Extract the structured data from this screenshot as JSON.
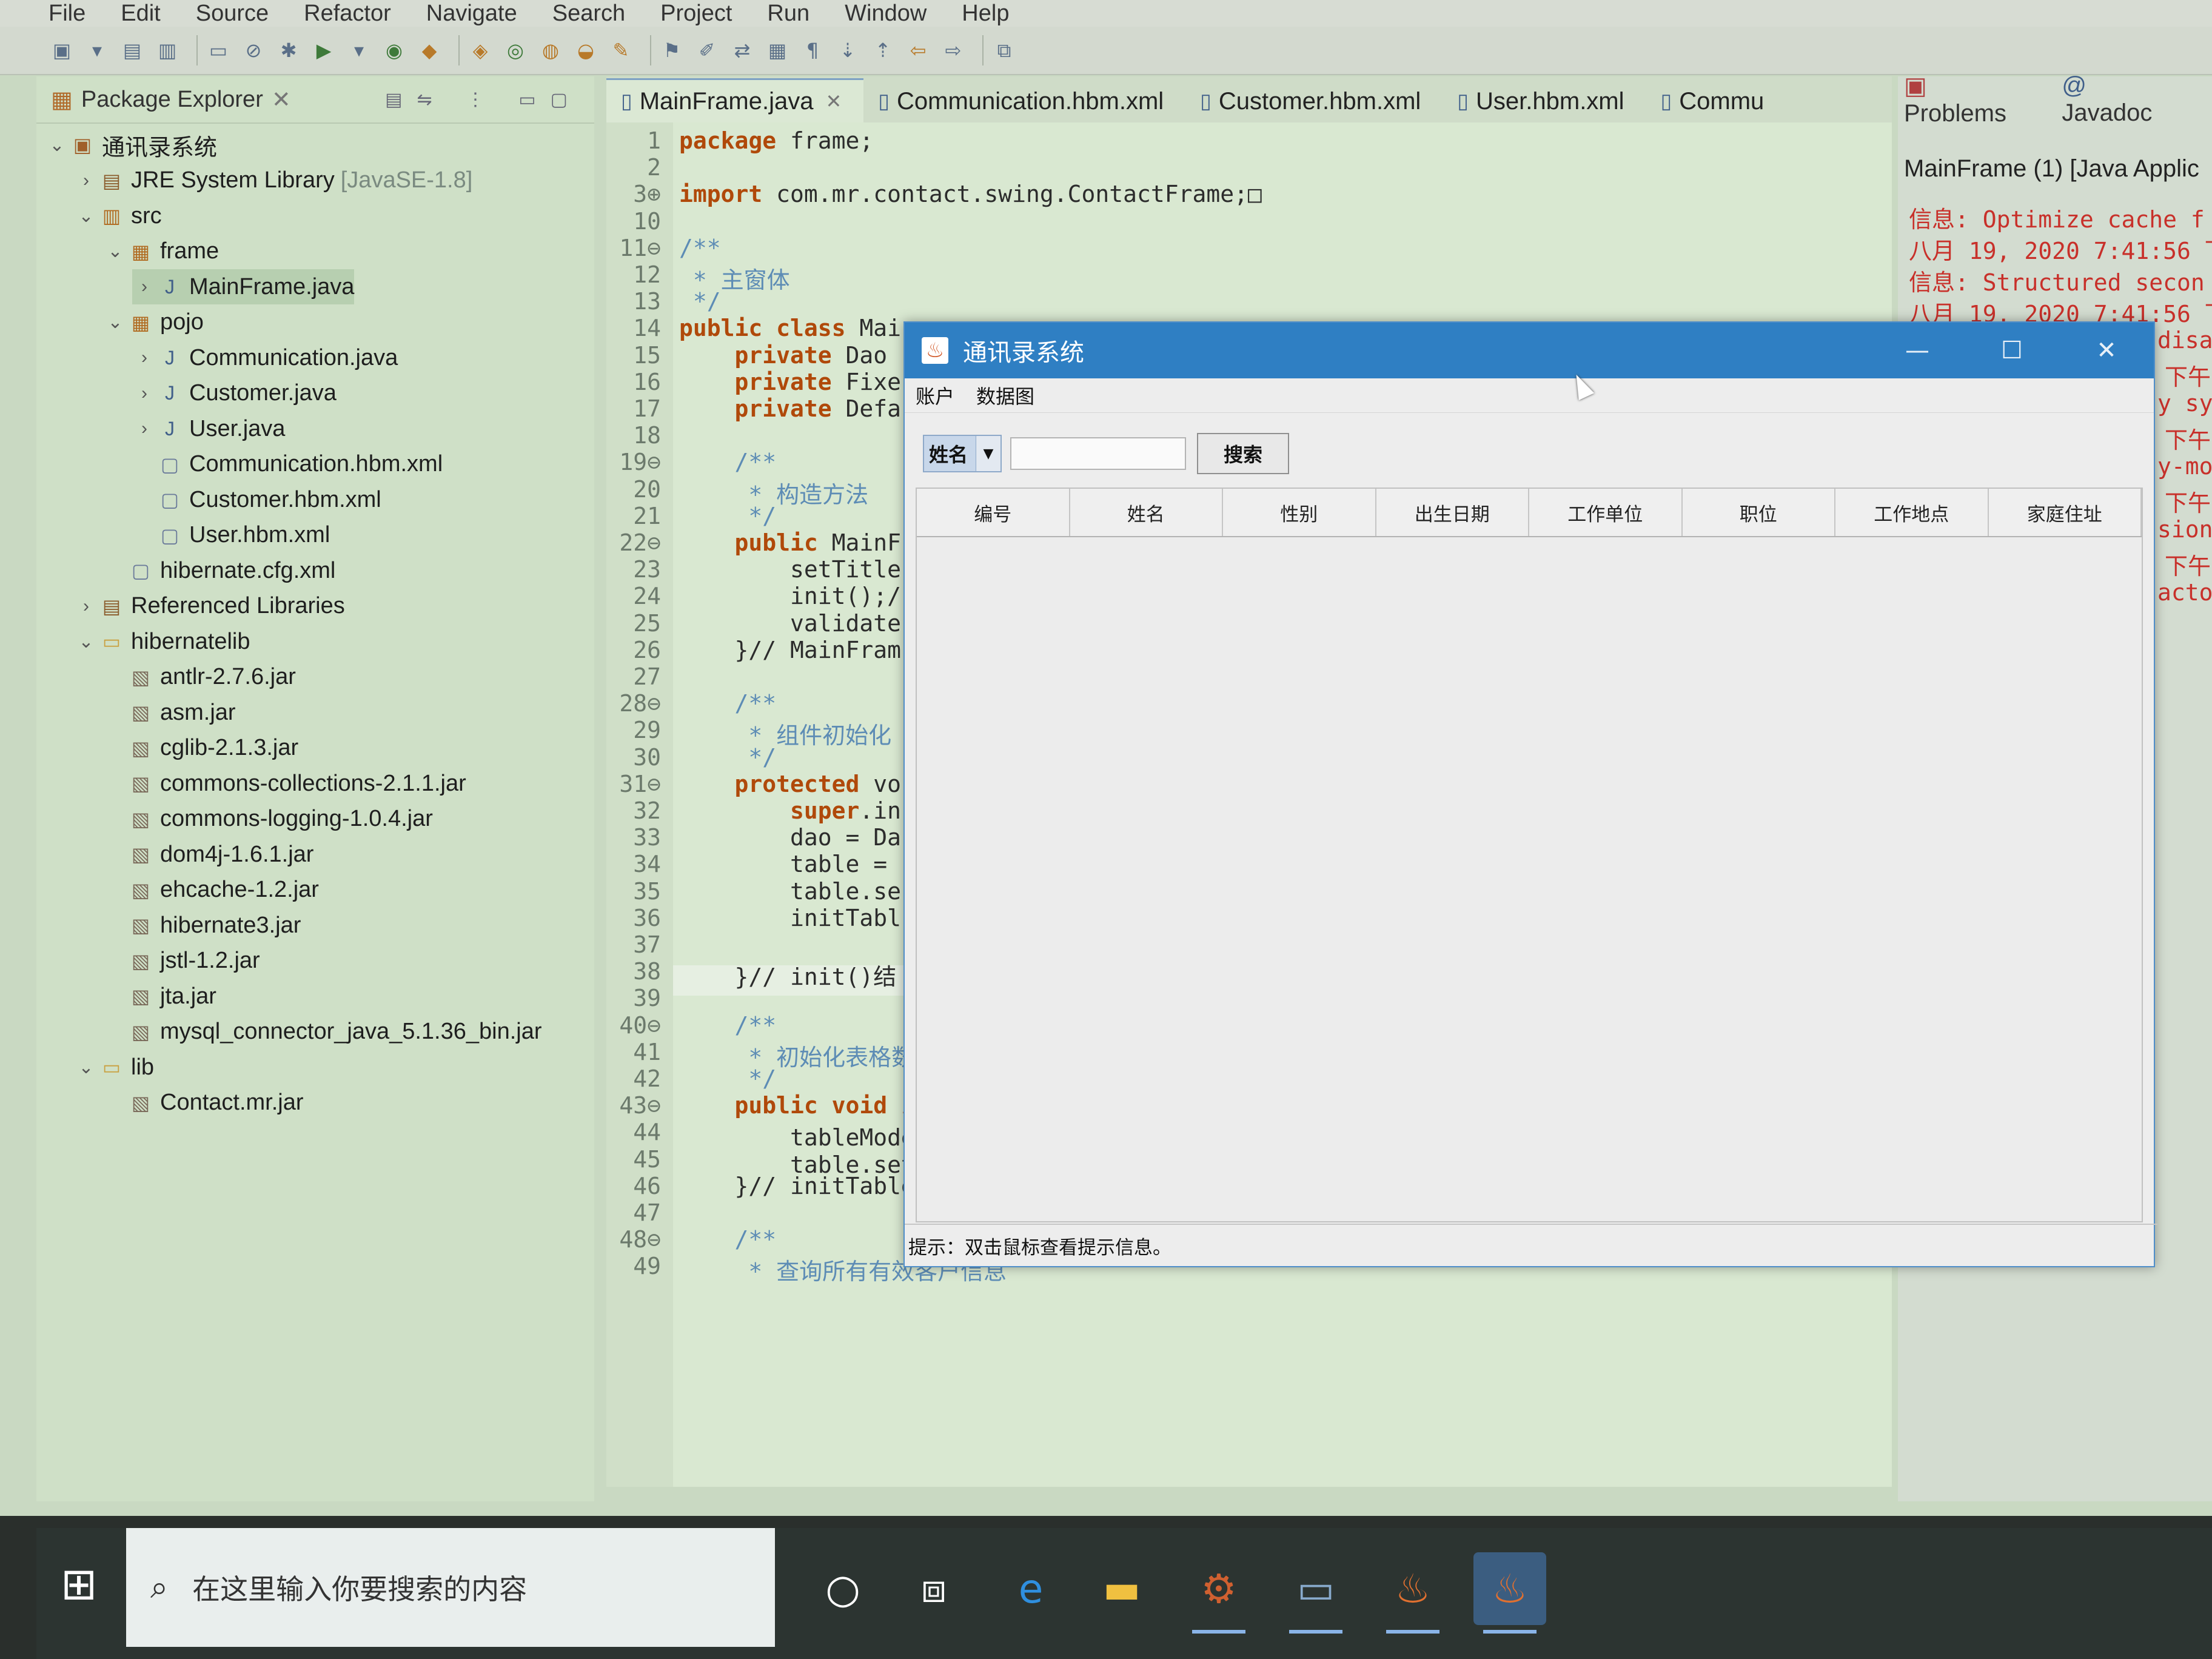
{
  "menubar": [
    "File",
    "Edit",
    "Source",
    "Refactor",
    "Navigate",
    "Search",
    "Project",
    "Run",
    "Window",
    "Help"
  ],
  "package_explorer": {
    "title": "Package Explorer",
    "tree": [
      {
        "label": "通讯录系统",
        "suffix": "",
        "icon": "project-icon",
        "depth": 0,
        "arrow": "v"
      },
      {
        "label": "JRE System Library",
        "suffix": "[JavaSE-1.8]",
        "icon": "library-icon",
        "depth": 1,
        "arrow": ">"
      },
      {
        "label": "src",
        "suffix": "",
        "icon": "source-folder-icon",
        "depth": 1,
        "arrow": "v"
      },
      {
        "label": "frame",
        "suffix": "",
        "icon": "package-icon",
        "depth": 2,
        "arrow": "v"
      },
      {
        "label": "MainFrame.java",
        "suffix": "",
        "icon": "java-file-icon",
        "depth": 3,
        "arrow": ">",
        "selected": true
      },
      {
        "label": "pojo",
        "suffix": "",
        "icon": "package-icon",
        "depth": 2,
        "arrow": "v"
      },
      {
        "label": "Communication.java",
        "suffix": "",
        "icon": "java-file-icon",
        "depth": 3,
        "arrow": ">"
      },
      {
        "label": "Customer.java",
        "suffix": "",
        "icon": "java-file-icon",
        "depth": 3,
        "arrow": ">"
      },
      {
        "label": "User.java",
        "suffix": "",
        "icon": "java-file-icon",
        "depth": 3,
        "arrow": ">"
      },
      {
        "label": "Communication.hbm.xml",
        "suffix": "",
        "icon": "xml-file-icon",
        "depth": 3,
        "arrow": ""
      },
      {
        "label": "Customer.hbm.xml",
        "suffix": "",
        "icon": "xml-file-icon",
        "depth": 3,
        "arrow": ""
      },
      {
        "label": "User.hbm.xml",
        "suffix": "",
        "icon": "xml-file-icon",
        "depth": 3,
        "arrow": ""
      },
      {
        "label": "hibernate.cfg.xml",
        "suffix": "",
        "icon": "xml-file-icon",
        "depth": 2,
        "arrow": ""
      },
      {
        "label": "Referenced Libraries",
        "suffix": "",
        "icon": "library-icon",
        "depth": 1,
        "arrow": ">"
      },
      {
        "label": "hibernatelib",
        "suffix": "",
        "icon": "folder-icon",
        "depth": 1,
        "arrow": "v"
      },
      {
        "label": "antlr-2.7.6.jar",
        "suffix": "",
        "icon": "jar-icon",
        "depth": 2,
        "arrow": ""
      },
      {
        "label": "asm.jar",
        "suffix": "",
        "icon": "jar-icon",
        "depth": 2,
        "arrow": ""
      },
      {
        "label": "cglib-2.1.3.jar",
        "suffix": "",
        "icon": "jar-icon",
        "depth": 2,
        "arrow": ""
      },
      {
        "label": "commons-collections-2.1.1.jar",
        "suffix": "",
        "icon": "jar-icon",
        "depth": 2,
        "arrow": ""
      },
      {
        "label": "commons-logging-1.0.4.jar",
        "suffix": "",
        "icon": "jar-icon",
        "depth": 2,
        "arrow": ""
      },
      {
        "label": "dom4j-1.6.1.jar",
        "suffix": "",
        "icon": "jar-icon",
        "depth": 2,
        "arrow": ""
      },
      {
        "label": "ehcache-1.2.jar",
        "suffix": "",
        "icon": "jar-icon",
        "depth": 2,
        "arrow": ""
      },
      {
        "label": "hibernate3.jar",
        "suffix": "",
        "icon": "jar-icon",
        "depth": 2,
        "arrow": ""
      },
      {
        "label": "jstl-1.2.jar",
        "suffix": "",
        "icon": "jar-icon",
        "depth": 2,
        "arrow": ""
      },
      {
        "label": "jta.jar",
        "suffix": "",
        "icon": "jar-icon",
        "depth": 2,
        "arrow": ""
      },
      {
        "label": "mysql_connector_java_5.1.36_bin.jar",
        "suffix": "",
        "icon": "jar-icon",
        "depth": 2,
        "arrow": ""
      },
      {
        "label": "lib",
        "suffix": "",
        "icon": "folder-icon",
        "depth": 1,
        "arrow": "v"
      },
      {
        "label": "Contact.mr.jar",
        "suffix": "",
        "icon": "jar-icon",
        "depth": 2,
        "arrow": ""
      }
    ]
  },
  "editor_tabs": [
    {
      "label": "MainFrame.java",
      "active": true,
      "closable": true
    },
    {
      "label": "Communication.hbm.xml",
      "active": false,
      "closable": false
    },
    {
      "label": "Customer.hbm.xml",
      "active": false,
      "closable": false
    },
    {
      "label": "User.hbm.xml",
      "active": false,
      "closable": false
    },
    {
      "label": "Commu",
      "active": false,
      "closable": false
    }
  ],
  "code_lines": [
    {
      "n": "1",
      "html": "<span class='kw'>package</span> <span class='pl'>frame</span>;"
    },
    {
      "n": "2",
      "html": ""
    },
    {
      "n": "3⊕",
      "html": "<span class='kw'>import</span> com.mr.contact.swing.ContactFrame;□"
    },
    {
      "n": "10",
      "html": ""
    },
    {
      "n": "11⊖",
      "html": "<span class='cm'>/**</span>"
    },
    {
      "n": "12",
      "html": "<span class='cm'> * 主窗体</span>"
    },
    {
      "n": "13",
      "html": "<span class='cm'> */</span>"
    },
    {
      "n": "14",
      "html": "<span class='kw'>public class</span> Mai"
    },
    {
      "n": "15",
      "html": "    <span class='kw'>private</span> Dao"
    },
    {
      "n": "16",
      "html": "    <span class='kw'>private</span> Fixe"
    },
    {
      "n": "17",
      "html": "    <span class='kw'>private</span> Defa"
    },
    {
      "n": "18",
      "html": ""
    },
    {
      "n": "19⊖",
      "html": "    <span class='cm'>/**</span>"
    },
    {
      "n": "20",
      "html": "<span class='cm'>     * 构造方法</span>"
    },
    {
      "n": "21",
      "html": "<span class='cm'>     */</span>"
    },
    {
      "n": "22⊖",
      "html": "    <span class='kw'>public</span> MainF"
    },
    {
      "n": "23",
      "html": "        setTitle"
    },
    {
      "n": "24",
      "html": "        init();/"
    },
    {
      "n": "25",
      "html": "        validate"
    },
    {
      "n": "26",
      "html": "    }// MainFram"
    },
    {
      "n": "27",
      "html": ""
    },
    {
      "n": "28⊖",
      "html": "    <span class='cm'>/**</span>"
    },
    {
      "n": "29",
      "html": "<span class='cm'>     * 组件初始化</span>"
    },
    {
      "n": "30",
      "html": "<span class='cm'>     */</span>"
    },
    {
      "n": "31⊖",
      "html": "    <span class='kw'>protected</span> vo"
    },
    {
      "n": "32",
      "html": "        <span class='kw'>super</span>.in"
    },
    {
      "n": "33",
      "html": "        dao = Da"
    },
    {
      "n": "34",
      "html": "        table = "
    },
    {
      "n": "35",
      "html": "        table.se"
    },
    {
      "n": "36",
      "html": "        initTabl"
    },
    {
      "n": "37",
      "html": ""
    },
    {
      "n": "38",
      "html": "    }// init()结"
    },
    {
      "n": "39",
      "html": ""
    },
    {
      "n": "40⊖",
      "html": "    <span class='cm'>/**</span>"
    },
    {
      "n": "41",
      "html": "<span class='cm'>     * 初始化表格数</span>"
    },
    {
      "n": "42",
      "html": "<span class='cm'>     */</span>"
    },
    {
      "n": "43⊖",
      "html": "    <span class='kw'>public void</span> <span class='fn'>initTable</span>() {"
    },
    {
      "n": "44",
      "html": "        tableModel = getUsableModleSoure();// 获取所有有效客户信息"
    },
    {
      "n": "45",
      "html": "        table.setModel(tableModel);// 客户信息表格加载数据模型"
    },
    {
      "n": "46",
      "html": "    }// initTable()"
    },
    {
      "n": "47",
      "html": ""
    },
    {
      "n": "48⊖",
      "html": "    <span class='cm'>/**</span>"
    },
    {
      "n": "49",
      "html": "<span class='cm'>     * 查询所有有效客户信息</span>"
    }
  ],
  "right_panel": {
    "tabs": [
      "Problems",
      "Javadoc"
    ],
    "title": "MainFrame (1) [Java Applic",
    "lines": [
      "信息: Optimize cache f",
      "八月 19, 2020 7:41:56 下午",
      "信息: Structured secon",
      "八月 19, 2020 7:41:56 下午",
      "disal",
      "下午",
      "y sy",
      "下午",
      "y-mo",
      "下午",
      "sion",
      "下午",
      "acto"
    ]
  },
  "dialog": {
    "title": "通讯录系统",
    "menu": [
      "账户",
      "数据图"
    ],
    "search_field": "姓名",
    "search_value": "",
    "search_button": "搜索",
    "columns": [
      "编号",
      "姓名",
      "性别",
      "出生日期",
      "工作单位",
      "职位",
      "工作地点",
      "家庭住址"
    ],
    "status": "提示：双击鼠标查看提示信息。"
  },
  "taskbar": {
    "search_placeholder": "在这里输入你要搜索的内容"
  }
}
